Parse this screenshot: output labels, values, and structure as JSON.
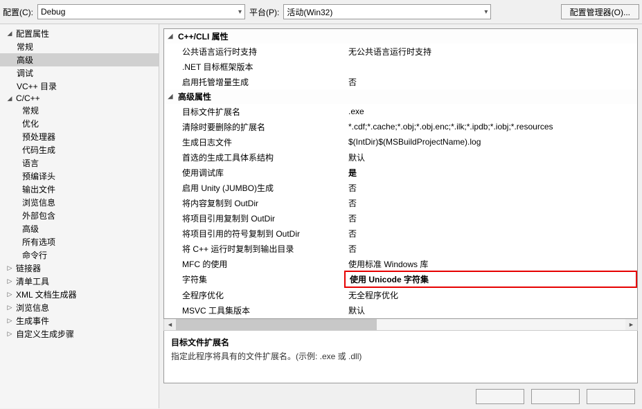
{
  "top": {
    "config_label": "配置(C):",
    "config_value": "Debug",
    "platform_label": "平台(P):",
    "platform_value": "活动(Win32)",
    "manager_button": "配置管理器(O)..."
  },
  "tree": {
    "root": "配置属性",
    "items_lvl1": [
      {
        "label": "常规",
        "leaf": true
      },
      {
        "label": "高级",
        "leaf": true,
        "selected": true
      },
      {
        "label": "调试",
        "leaf": true
      },
      {
        "label": "VC++ 目录",
        "leaf": true
      },
      {
        "label": "C/C++",
        "leaf": false,
        "expanded": true
      },
      {
        "label": "链接器",
        "leaf": false,
        "expanded": false
      },
      {
        "label": "清单工具",
        "leaf": false,
        "expanded": false
      },
      {
        "label": "XML 文档生成器",
        "leaf": false,
        "expanded": false
      },
      {
        "label": "浏览信息",
        "leaf": false,
        "expanded": false
      },
      {
        "label": "生成事件",
        "leaf": false,
        "expanded": false
      },
      {
        "label": "自定义生成步骤",
        "leaf": false,
        "expanded": false
      }
    ],
    "cxx_children": [
      "常规",
      "优化",
      "预处理器",
      "代码生成",
      "语言",
      "预编译头",
      "输出文件",
      "浏览信息",
      "外部包含",
      "高级",
      "所有选项",
      "命令行"
    ]
  },
  "props": {
    "cat1": "C++/CLI 属性",
    "cat1_rows": [
      {
        "name": "公共语言运行时支持",
        "value": "无公共语言运行时支持"
      },
      {
        "name": ".NET 目标框架版本",
        "value": ""
      },
      {
        "name": "启用托管增量生成",
        "value": "否"
      }
    ],
    "cat2": "高级属性",
    "cat2_rows": [
      {
        "name": "目标文件扩展名",
        "value": ".exe"
      },
      {
        "name": "清除时要删除的扩展名",
        "value": "*.cdf;*.cache;*.obj;*.obj.enc;*.ilk;*.ipdb;*.iobj;*.resources"
      },
      {
        "name": "生成日志文件",
        "value": "$(IntDir)$(MSBuildProjectName).log"
      },
      {
        "name": "首选的生成工具体系结构",
        "value": "默认"
      },
      {
        "name": "使用调试库",
        "value": "是",
        "bold": true
      },
      {
        "name": "启用 Unity (JUMBO)生成",
        "value": "否"
      },
      {
        "name": "将内容复制到 OutDir",
        "value": "否"
      },
      {
        "name": "将项目引用复制到 OutDir",
        "value": "否"
      },
      {
        "name": "将项目引用的符号复制到 OutDir",
        "value": "否"
      },
      {
        "name": "将 C++ 运行时复制到输出目录",
        "value": "否"
      },
      {
        "name": "MFC 的使用",
        "value": "使用标准 Windows 库"
      },
      {
        "name": "字符集",
        "value": "使用 Unicode 字符集",
        "highlight": true
      },
      {
        "name": "全程序优化",
        "value": "无全程序优化"
      },
      {
        "name": "MSVC 工具集版本",
        "value": "默认"
      }
    ]
  },
  "desc": {
    "title": "目标文件扩展名",
    "text": "指定此程序将具有的文件扩展名。(示例: .exe 或 .dll)"
  }
}
